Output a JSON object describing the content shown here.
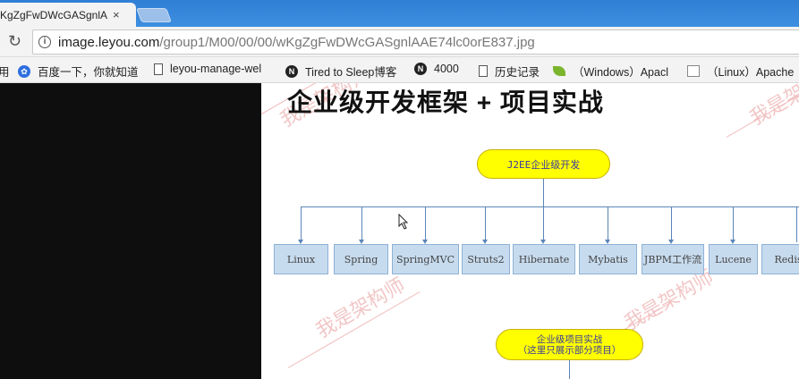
{
  "browser": {
    "tab_title": "KgZgFwDWcGASgnlA",
    "tab_close": "×",
    "url_host": "image.leyou.com",
    "url_path": "/group1/M00/00/00/wKgZgFwDWcGASgnlAAE74lc0orE837.jpg"
  },
  "bookmarks": [
    {
      "label": "用",
      "icon": "app-icon"
    },
    {
      "label": "百度一下，你就知道",
      "icon": "baidu-paw-icon"
    },
    {
      "label": "leyou-manage-wel",
      "icon": "page-icon"
    },
    {
      "label": "Tired to Sleep博客",
      "icon": "n-logo-icon"
    },
    {
      "label": "4000",
      "icon": "n-logo-icon"
    },
    {
      "label": "历史记录",
      "icon": "page-icon"
    },
    {
      "label": "（Windows）Apacl",
      "icon": "leaf-icon"
    },
    {
      "label": "（Linux）Apache",
      "icon": "image-icon"
    }
  ],
  "image": {
    "heading": "企业级开发框架 + 项目实战",
    "root_node": "J2EE企业级开发",
    "frameworks": [
      "Linux",
      "Spring",
      "SpringMVC",
      "Struts2",
      "Hibernate",
      "Mybatis",
      "JBPM工作流",
      "Lucene",
      "Redis"
    ],
    "project_node_line1": "企业级项目实战",
    "project_node_line2": "（这里只展示部分项目）",
    "watermark": "我是架构师"
  }
}
